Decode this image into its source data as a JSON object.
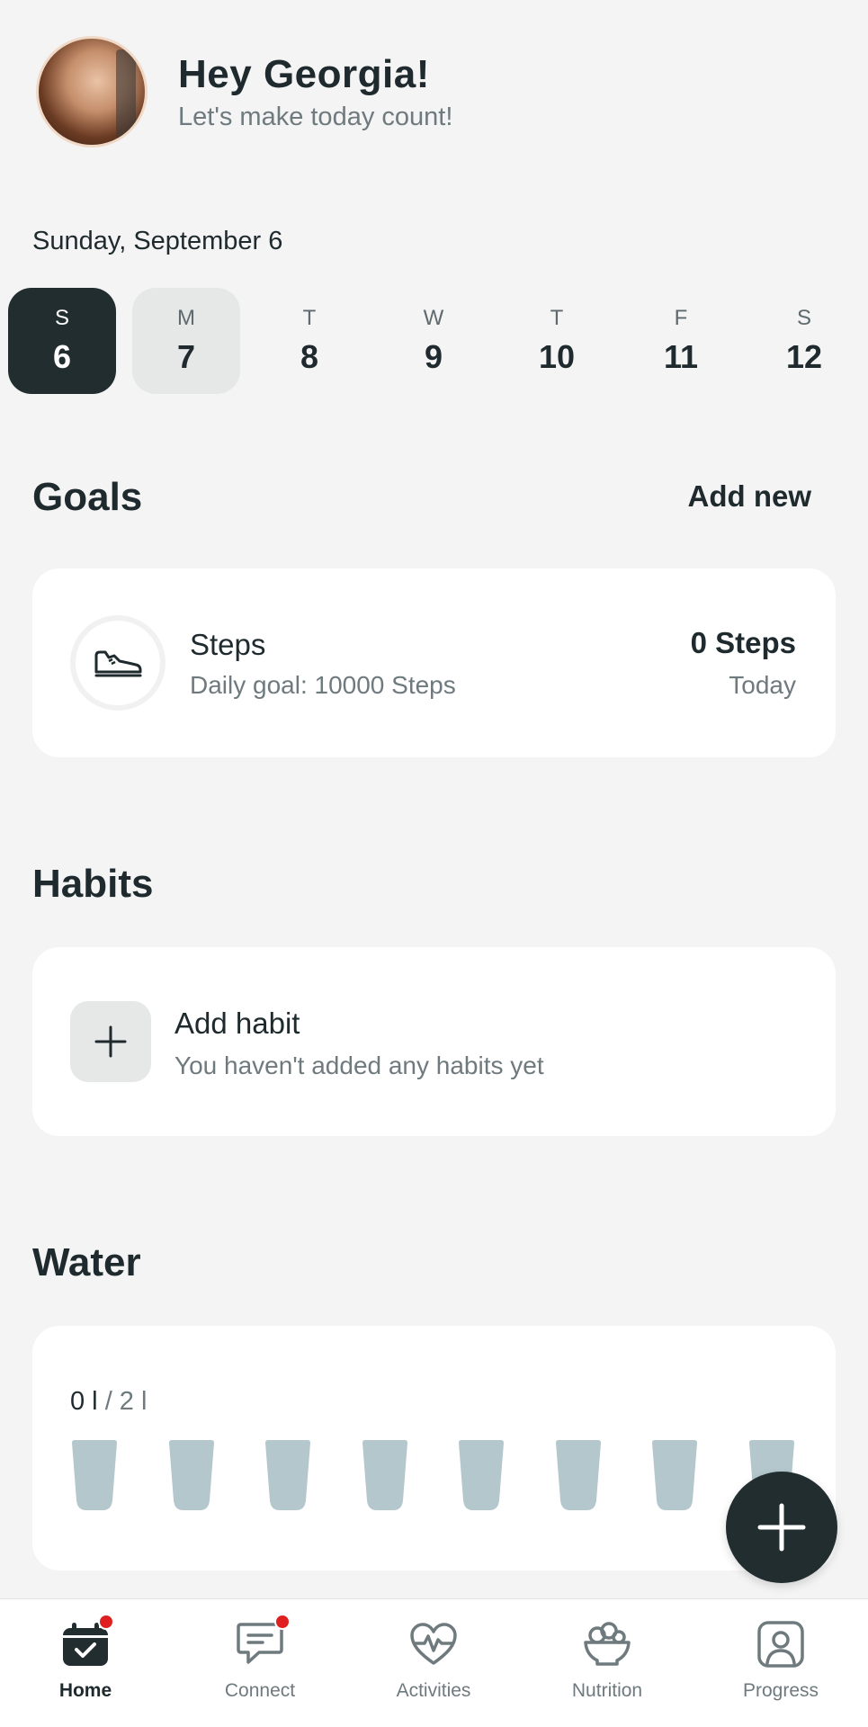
{
  "header": {
    "greeting": "Hey Georgia!",
    "subtitle": "Let's make today count!"
  },
  "date": "Sunday, September 6",
  "week": [
    {
      "letter": "S",
      "num": "6",
      "state": "selected"
    },
    {
      "letter": "M",
      "num": "7",
      "state": "soft"
    },
    {
      "letter": "T",
      "num": "8",
      "state": "normal"
    },
    {
      "letter": "W",
      "num": "9",
      "state": "normal"
    },
    {
      "letter": "T",
      "num": "10",
      "state": "normal"
    },
    {
      "letter": "F",
      "num": "11",
      "state": "normal"
    },
    {
      "letter": "S",
      "num": "12",
      "state": "normal"
    }
  ],
  "goals": {
    "title": "Goals",
    "add_new": "Add new",
    "steps": {
      "title": "Steps",
      "daily_goal": "Daily goal:  10000 Steps",
      "value": "0 Steps",
      "when": "Today",
      "icon": "shoe-icon"
    }
  },
  "habits": {
    "title": "Habits",
    "add_title": "Add habit",
    "add_sub": "You haven't added any habits yet",
    "icon": "plus-icon"
  },
  "water": {
    "title": "Water",
    "current": "0 l",
    "goal": " / 2 l",
    "glass_count": 8,
    "glass_color": "#b3c7cd"
  },
  "colors": {
    "dark": "#222d2f",
    "notification": "#e02020"
  },
  "nav": [
    {
      "label": "Home",
      "icon": "calendar-check-icon",
      "active": true,
      "badge": true
    },
    {
      "label": "Connect",
      "icon": "chat-icon",
      "active": false,
      "badge": true
    },
    {
      "label": "Activities",
      "icon": "heart-pulse-icon",
      "active": false,
      "badge": false
    },
    {
      "label": "Nutrition",
      "icon": "salad-bowl-icon",
      "active": false,
      "badge": false
    },
    {
      "label": "Progress",
      "icon": "profile-icon",
      "active": false,
      "badge": false
    }
  ]
}
